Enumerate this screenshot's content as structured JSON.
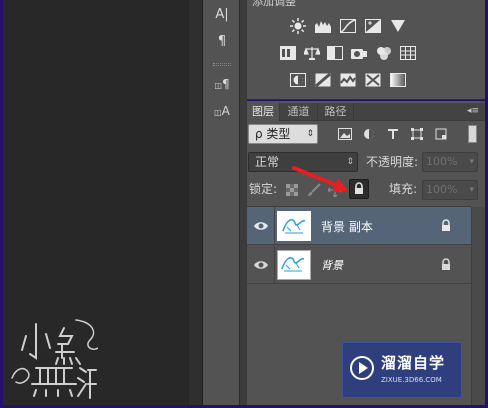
{
  "colors": {
    "frame": "#24106a",
    "panel": "#535353",
    "selected_layer": "#566478",
    "arrow": "#e52020",
    "watermark_bg": "#2f3e7c"
  },
  "adjustments": {
    "title": "添加调整",
    "icons": [
      "brightness-icon",
      "levels-icon",
      "curves-icon",
      "exposure-icon",
      "vibrance-icon",
      "hue-saturation-icon",
      "color-balance-icon",
      "black-white-icon",
      "photo-filter-icon",
      "channel-mixer-icon",
      "color-lookup-icon",
      "invert-icon",
      "posterize-icon",
      "threshold-icon",
      "selective-color-icon",
      "gradient-map-icon"
    ]
  },
  "tools": {
    "char_a": "A|",
    "para": "¶",
    "para_styles": "¶",
    "char_styles": "A"
  },
  "tabs": [
    "图层",
    "通道",
    "路径"
  ],
  "filter": {
    "label": "ρ 类型",
    "icons": [
      "image-filter-icon",
      "adjustment-filter-icon",
      "type-filter-icon",
      "shape-filter-icon",
      "smart-object-filter-icon"
    ]
  },
  "blend": {
    "mode": "正常",
    "opacity_label": "不透明度:",
    "opacity_value": "100%"
  },
  "lock": {
    "label": "锁定:",
    "fill_label": "填充:",
    "fill_value": "100%"
  },
  "layers": [
    {
      "name": "背景 副本",
      "selected": true,
      "italic": false
    },
    {
      "name": "背景",
      "selected": false,
      "italic": true
    }
  ],
  "signature": {
    "text": "小鱼 無海"
  },
  "watermark": {
    "title": "溜溜自学",
    "url": "ZIXUE.3D66.COM"
  }
}
